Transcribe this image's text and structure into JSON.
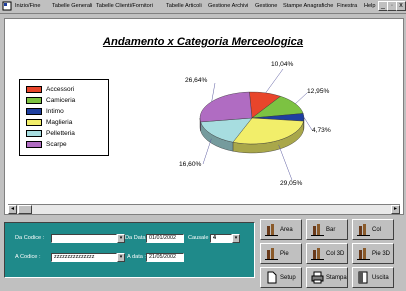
{
  "menu": {
    "items": [
      "Inizio/Fine",
      "Tabelle Generali",
      "Tabelle Clienti/Fornitori",
      "Tabelle Articoli",
      "Gestione Archivi",
      "Gestione",
      "Stampe Anagrafiche",
      "Finestra",
      "Help"
    ],
    "window_buttons": [
      "_",
      "·",
      "x"
    ]
  },
  "chart": {
    "title": "Andamento x Categoria Merceologica"
  },
  "chart_data": {
    "type": "pie",
    "title": "Andamento x Categoria Merceologica",
    "categories": [
      "Accessori",
      "Camiceria",
      "Intimo",
      "Maglieria",
      "Pelletteria",
      "Scarpe"
    ],
    "values": [
      10.04,
      12.95,
      4.73,
      29.05,
      16.6,
      26.64
    ],
    "labels": [
      "10,04%",
      "12,95%",
      "4,73%",
      "29,05%",
      "16,60%",
      "26,64%"
    ],
    "colors": [
      "#e8452b",
      "#7cc242",
      "#1e3fa0",
      "#f2ee6a",
      "#a7dde0",
      "#b06cc2"
    ],
    "legend_position": "left"
  },
  "filters": {
    "da_codice_label": "Da Codice :",
    "da_codice_value": "",
    "a_codice_label": "A Codice :",
    "a_codice_value": "zzzzzzzzzzzzzzz",
    "da_data_label": "Da Data :",
    "da_data_value": "01/01/2002",
    "a_data_label": "A data :",
    "a_data_value": "21/05/2002",
    "causale_label": "Causale :",
    "causale_value": "4"
  },
  "buttons": {
    "area": "Area",
    "bar": "Bar",
    "col": "Col",
    "pie": "Pie",
    "col3d": "Col 3D",
    "pie3d": "Pie 3D",
    "setup": "Setup",
    "stampa": "Stampa",
    "uscita": "Uscita"
  }
}
